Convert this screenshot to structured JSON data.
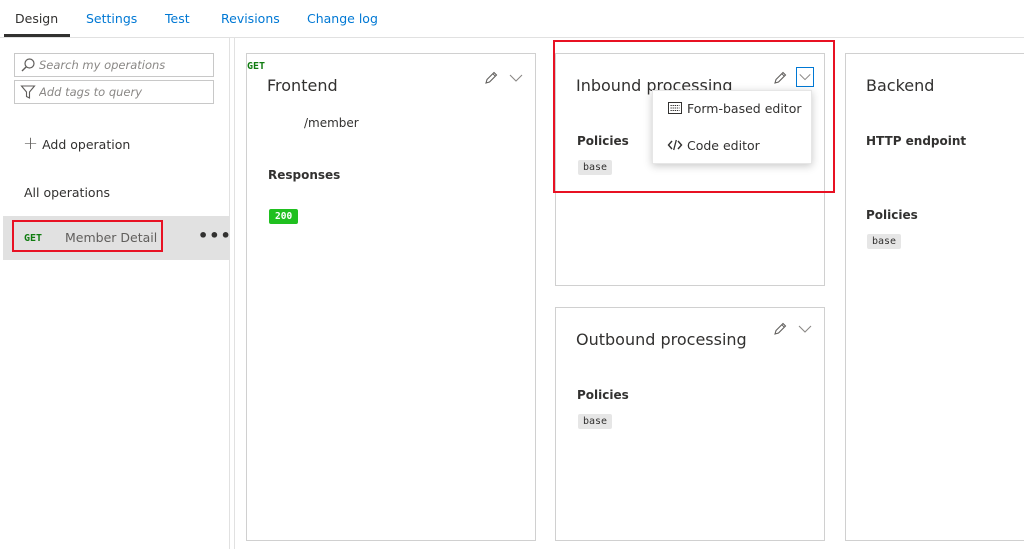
{
  "tabs": [
    {
      "label": "Design"
    },
    {
      "label": "Settings"
    },
    {
      "label": "Test"
    },
    {
      "label": "Revisions"
    },
    {
      "label": "Change log"
    }
  ],
  "sidebar": {
    "search_placeholder": "Search my operations",
    "tags_placeholder": "Add tags to query",
    "add_operation": "Add operation",
    "all_operations": "All operations",
    "operation": {
      "method": "GET",
      "name": "Member Detail",
      "more": "•••"
    }
  },
  "frontend": {
    "title": "Frontend",
    "method": "GET",
    "path": "/member",
    "responses_label": "Responses",
    "response_code": "200"
  },
  "inbound": {
    "title": "Inbound processing",
    "policies_label": "Policies",
    "policy": "base"
  },
  "outbound": {
    "title": "Outbound processing",
    "policies_label": "Policies",
    "policy": "base"
  },
  "backend": {
    "title": "Backend",
    "endpoint_label": "HTTP endpoint",
    "policies_label": "Policies",
    "policy": "base"
  },
  "menu": {
    "form_editor": "Form-based editor",
    "code_editor": "Code editor"
  },
  "colors": {
    "link": "#0078d4",
    "highlight_red": "#e81123",
    "get_green": "#107c10",
    "status_green": "#20c020"
  }
}
